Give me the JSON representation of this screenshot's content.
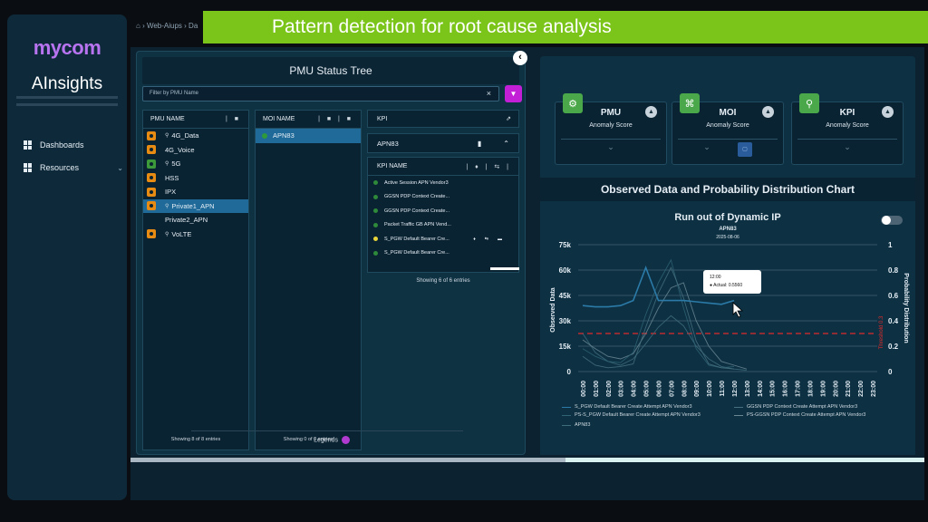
{
  "banner": {
    "title": "Pattern detection for root cause analysis"
  },
  "breadcrumb": {
    "home_icon": "home-icon",
    "items": [
      "Web-Aiups",
      "Da"
    ]
  },
  "brand": {
    "name": "mycom",
    "product": "AInsights",
    "accent": "#b874f0"
  },
  "sidebar": {
    "items": [
      {
        "label": "Dashboards",
        "icon": "grid-icon"
      },
      {
        "label": "Resources",
        "icon": "grid-icon",
        "chevron": "chevron-down-icon"
      }
    ]
  },
  "pmu_panel": {
    "title": "PMU Status Tree",
    "filter_placeholder": "Filter by PMU Name",
    "clear": "×",
    "pmu_column": {
      "header": "PMU NAME",
      "rows": [
        {
          "label": "4G_Data",
          "badge": "orange",
          "pin": true
        },
        {
          "label": "4G_Voice",
          "badge": "orange",
          "pin": false
        },
        {
          "label": "5G",
          "badge": "green",
          "pin": true
        },
        {
          "label": "HSS",
          "badge": "orange",
          "pin": false
        },
        {
          "label": "IPX",
          "badge": "orange",
          "pin": false
        },
        {
          "label": "Private1_APN",
          "badge": "orange",
          "pin": true,
          "selected": true
        },
        {
          "label": "Private2_APN",
          "badge": "none",
          "pin": false
        },
        {
          "label": "VoLTE",
          "badge": "orange",
          "pin": true
        }
      ],
      "footer": "Showing 8 of 8 entries"
    },
    "moi_column": {
      "header": "MOI NAME",
      "rows": [
        {
          "label": "APN83",
          "selected": true
        }
      ],
      "footer": "Showing 0 of 0 entries"
    },
    "kpi_column": {
      "header": "KPI",
      "group": "APN83",
      "list_header": "KPI NAME",
      "rows": [
        {
          "label": "Active Session APN Vendor3",
          "dot": "green"
        },
        {
          "label": "GGSN PDP Context Create...",
          "dot": "green"
        },
        {
          "label": "GGSN PDP Context Create...",
          "dot": "green"
        },
        {
          "label": "Packet Traffic GB APN Vend...",
          "dot": "green"
        },
        {
          "label": "S_PGW Default Bearer Cre...",
          "dot": "yellow"
        },
        {
          "label": "S_PGW Default Bearer Cre...",
          "dot": "green"
        }
      ],
      "footer": "Showing 6 of 6 entries"
    },
    "legends_label": "Legends"
  },
  "score_cards": [
    {
      "title": "PMU",
      "subtitle": "Anomaly Score",
      "icon": "gear-icon"
    },
    {
      "title": "MOI",
      "subtitle": "Anomaly Score",
      "icon": "network-icon"
    },
    {
      "title": "KPI",
      "subtitle": "Anomaly Score",
      "icon": "search-icon"
    }
  ],
  "chart_panel": {
    "panel_title": "Observed Data and Probability Distribution Chart",
    "toggle_on": false,
    "tooltip": {
      "time": "12:00",
      "label": "Actual: 0.5560"
    }
  },
  "chart_data": {
    "type": "line",
    "title": "Run out of Dynamic IP",
    "subtitle": "APN83",
    "date": "2025-08-06",
    "ylabel": "Observed Data",
    "y2label": "Probability Distribution",
    "threshold_label": "Threshold 0.3",
    "threshold": 0.3,
    "ylim": [
      0,
      75000
    ],
    "y2lim": [
      0,
      1
    ],
    "yticks": [
      "0",
      "15k",
      "30k",
      "45k",
      "60k",
      "75k"
    ],
    "y2ticks": [
      "0",
      "0.2",
      "0.4",
      "0.6",
      "0.8",
      "1"
    ],
    "x": [
      "00:00",
      "01:00",
      "02:00",
      "03:00",
      "04:00",
      "05:00",
      "06:00",
      "07:00",
      "08:00",
      "09:00",
      "10:00",
      "11:00",
      "12:00",
      "13:00",
      "14:00",
      "15:00",
      "16:00",
      "17:00",
      "18:00",
      "19:00",
      "20:00",
      "21:00",
      "22:00",
      "23:00"
    ],
    "series": [
      {
        "name": "S_PGW Default Bearer Create Attempt APN Vendor3",
        "axis": "y2",
        "color": "#2b7aa8",
        "values": [
          0.52,
          0.51,
          0.51,
          0.52,
          0.56,
          0.82,
          0.56,
          0.56,
          0.56,
          0.55,
          0.54,
          0.53,
          0.56,
          null,
          null,
          null,
          null,
          null,
          null,
          null,
          null,
          null,
          null,
          null
        ]
      },
      {
        "name": "GGSN PDP Context Create Attempt APN Vendor3",
        "axis": "y2",
        "color": "#47707f",
        "values": [
          0.12,
          0.05,
          0.03,
          0.04,
          0.06,
          0.35,
          0.62,
          0.82,
          0.58,
          0.24,
          0.06,
          0.03,
          0.02,
          null,
          null,
          null,
          null,
          null,
          null,
          null,
          null,
          null,
          null,
          null
        ]
      },
      {
        "name": "PS-S_PGW Default Bearer Create Attempt APN Vendor3",
        "axis": "y2",
        "color": "#2f6375",
        "values": [
          0.18,
          0.12,
          0.08,
          0.07,
          0.15,
          0.45,
          0.7,
          0.88,
          0.5,
          0.18,
          0.05,
          0.03,
          0.04,
          null,
          null,
          null,
          null,
          null,
          null,
          null,
          null,
          null,
          null,
          null
        ]
      },
      {
        "name": "PS-GGSN PDP Context Create Attempt APN Vendor3",
        "axis": "y2",
        "color": "#6b8794",
        "values": [
          0.25,
          0.18,
          0.12,
          0.1,
          0.14,
          0.3,
          0.5,
          0.66,
          0.7,
          0.4,
          0.2,
          0.08,
          0.05,
          0.02,
          null,
          null,
          null,
          null,
          null,
          null,
          null,
          null,
          null,
          null
        ]
      },
      {
        "name": "APN83",
        "axis": "y2",
        "color": "#3f6c7c",
        "values": [
          0.3,
          0.15,
          0.08,
          0.05,
          0.1,
          0.22,
          0.35,
          0.44,
          0.36,
          0.2,
          0.1,
          0.04,
          0.02,
          0.01,
          null,
          null,
          null,
          null,
          null,
          null,
          null,
          null,
          null,
          null
        ]
      }
    ]
  }
}
